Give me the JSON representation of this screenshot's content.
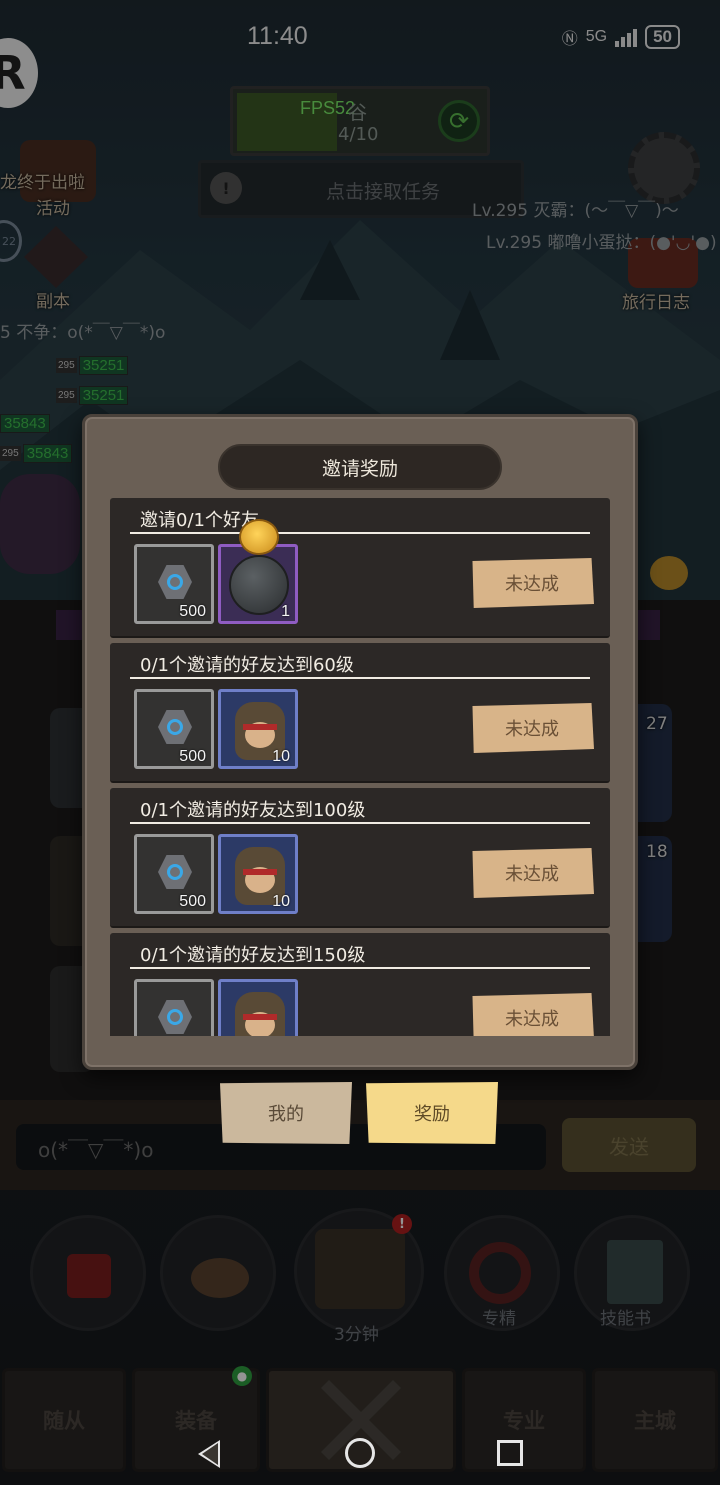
{
  "status_bar": {
    "time": "11:40",
    "network": "5G",
    "battery": "50"
  },
  "hud": {
    "fps": "FPS52",
    "zone_name": "谷",
    "zone_progress": "4/10",
    "task_button": "点击接取任务"
  },
  "side_menu": {
    "activity_banner": "龙终于出啦",
    "activity_label": "活动",
    "dungeon_label": "副本",
    "travel_log_label": "旅行日志",
    "level_badge": "22"
  },
  "chat_feed": [
    "Lv.295 灭霸：(～￣▽￣)～",
    "Lv.295 嘟噜小蛋挞：(●'◡'●)",
    "5 不争：o(*￣▽￣*)o"
  ],
  "party_hp": [
    {
      "level": "295",
      "hp": "35251"
    },
    {
      "level": "295",
      "hp": "35251"
    },
    {
      "level": "",
      "hp": "35843"
    },
    {
      "level": "295",
      "hp": "35843"
    }
  ],
  "side_counts": {
    "right_a": "27",
    "right_b": "18"
  },
  "modal": {
    "title": "邀请奖励",
    "rewards": [
      {
        "title": "邀请0/1个好友",
        "items": [
          {
            "icon": "gem-icon",
            "qty": "500",
            "rarity": "grey"
          },
          {
            "icon": "orb-icon",
            "qty": "1",
            "rarity": "purple"
          }
        ],
        "status": "未达成"
      },
      {
        "title": "0/1个邀请的好友达到60级",
        "items": [
          {
            "icon": "gem-icon",
            "qty": "500",
            "rarity": "grey"
          },
          {
            "icon": "hero-icon",
            "qty": "10",
            "rarity": "blue"
          }
        ],
        "status": "未达成"
      },
      {
        "title": "0/1个邀请的好友达到100级",
        "items": [
          {
            "icon": "gem-icon",
            "qty": "500",
            "rarity": "grey"
          },
          {
            "icon": "hero-icon",
            "qty": "10",
            "rarity": "blue"
          }
        ],
        "status": "未达成"
      },
      {
        "title": "0/1个邀请的好友达到150级",
        "items": [
          {
            "icon": "gem-icon",
            "qty": "",
            "rarity": "grey"
          },
          {
            "icon": "hero-icon",
            "qty": "",
            "rarity": "blue"
          }
        ],
        "status": "未达成"
      }
    ],
    "tabs": {
      "mine": "我的",
      "rewards": "奖励",
      "active": "rewards"
    }
  },
  "chat_input": {
    "value": "o(*￣▽￣*)o",
    "send": "发送"
  },
  "actions": {
    "chest_timer": "3分钟",
    "specialty": "专精",
    "skill_book": "技能书",
    "chest_badge": "!"
  },
  "bottom_nav": {
    "followers": "随从",
    "equipment": "装备",
    "specialty": "专业",
    "main_city": "主城"
  },
  "colors": {
    "modal_bg": "#6a5f55",
    "card_bg": "#2c2826",
    "status_btn": "#d8b489",
    "active_tab": "#f5d98a",
    "fps_green": "#7cf06a"
  }
}
